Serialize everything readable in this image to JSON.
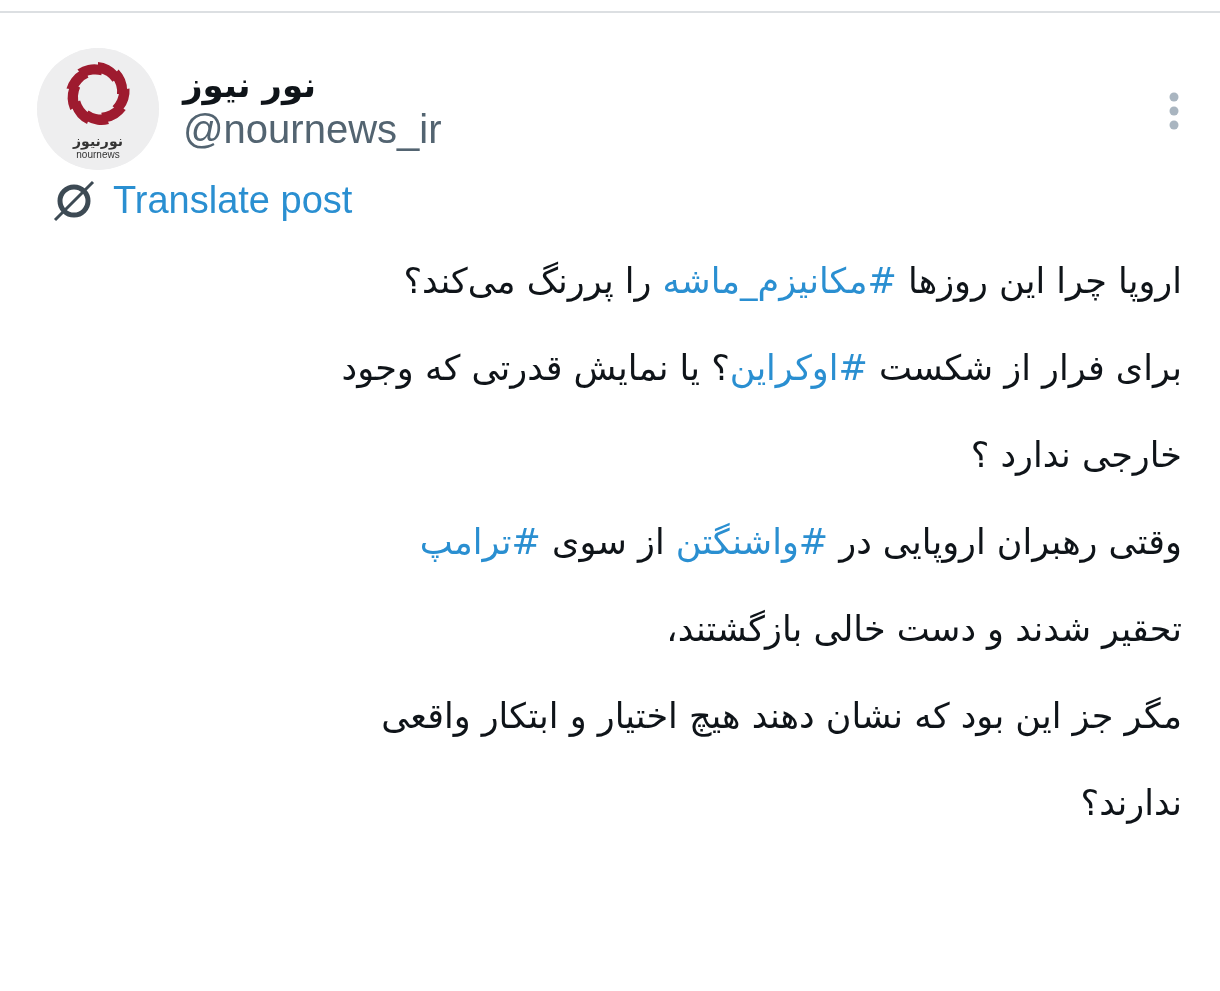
{
  "author": {
    "name": "نور نیوز",
    "handle": "@nournews_ir",
    "logo_text": "نورنیوز",
    "logo_caption": "nournews"
  },
  "translate": {
    "label": "Translate post"
  },
  "post": {
    "lines": [
      {
        "segments": [
          {
            "kind": "text",
            "text": "اروپا چرا این روزها "
          },
          {
            "kind": "hashtag",
            "text": "#مکانیزم_ماشه"
          },
          {
            "kind": "text",
            "text": " را پررنگ می‌کند؟"
          }
        ]
      },
      {
        "segments": [
          {
            "kind": "text",
            "text": "برای فرار از شکست "
          },
          {
            "kind": "hashtag",
            "text": "#اوکراین"
          },
          {
            "kind": "text",
            "text": "؟ یا نمایش قدرتی که وجود"
          }
        ]
      },
      {
        "segments": [
          {
            "kind": "text",
            "text": "خارجی ندارد ؟"
          }
        ]
      },
      {
        "segments": [
          {
            "kind": "text",
            "text": "وقتی رهبران اروپایی در "
          },
          {
            "kind": "hashtag",
            "text": "#واشنگتن"
          },
          {
            "kind": "text",
            "text": " از سوی "
          },
          {
            "kind": "hashtag",
            "text": "#ترامپ"
          }
        ]
      },
      {
        "segments": [
          {
            "kind": "text",
            "text": "تحقیر شدند و دست خالی بازگشتند،"
          }
        ]
      },
      {
        "segments": [
          {
            "kind": "text",
            "text": "مگر جز این بود که نشان دهند هیچ اختیار و ابتکار واقعی"
          }
        ]
      },
      {
        "segments": [
          {
            "kind": "text",
            "text": "ندارند؟"
          }
        ]
      }
    ]
  }
}
